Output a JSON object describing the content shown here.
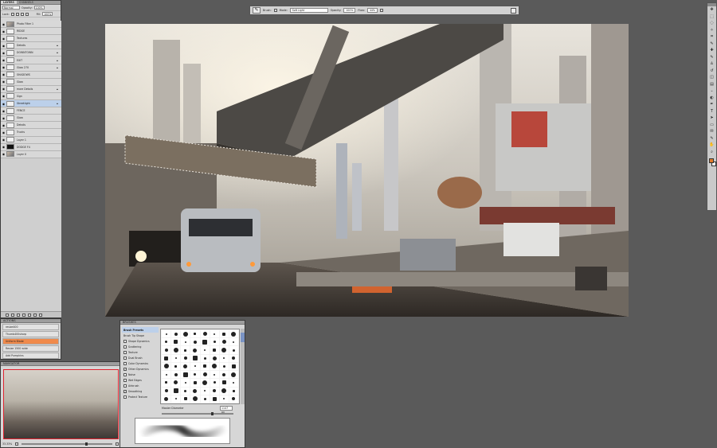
{
  "layers_panel": {
    "tabs": [
      {
        "label": "LAYERS"
      },
      {
        "label": "CHANNELS"
      }
    ],
    "blend_mode": "Normal",
    "opacity_label": "Opacity:",
    "opacity_value": "100%",
    "lock_label": "Lock:",
    "fill_label": "Fill:",
    "fill_value": "100%",
    "layers": [
      {
        "name": "Photo Filter 1",
        "visible": true,
        "locked": false
      },
      {
        "name": "RIDGE",
        "visible": true,
        "locked": false
      },
      {
        "name": "Textures",
        "visible": true,
        "locked": false
      },
      {
        "name": "Details",
        "visible": true,
        "locked": true
      },
      {
        "name": "DOWNTOWN",
        "visible": true,
        "locked": true
      },
      {
        "name": "EXIT",
        "visible": true,
        "locked": true
      },
      {
        "name": "Glow 270",
        "visible": true,
        "locked": true
      },
      {
        "name": "SHADOWS",
        "visible": true,
        "locked": false
      },
      {
        "name": "Glow",
        "visible": true,
        "locked": false
      },
      {
        "name": "more Details",
        "visible": true,
        "locked": true
      },
      {
        "name": "Sign",
        "visible": true,
        "locked": false
      },
      {
        "name": "Streetlight",
        "visible": true,
        "locked": true
      },
      {
        "name": "FENCE",
        "visible": true,
        "locked": false
      },
      {
        "name": "Glow",
        "visible": true,
        "locked": false
      },
      {
        "name": "Details",
        "visible": true,
        "locked": false
      },
      {
        "name": "Trucks",
        "visible": true,
        "locked": false
      },
      {
        "name": "Layer 1",
        "visible": true,
        "locked": false
      },
      {
        "name": "DODGE F4",
        "visible": true,
        "locked": false
      },
      {
        "name": "Layer 0",
        "visible": true,
        "locked": false
      }
    ],
    "selected_index": 11
  },
  "actions_panel": {
    "title": "ACTIONS",
    "items": [
      {
        "label": "resize400"
      },
      {
        "label": "Thumb400sharp"
      },
      {
        "label": "Uniform Blade"
      },
      {
        "label": "Resize 1500 wide"
      },
      {
        "label": "Add Pumpkins"
      }
    ],
    "highlighted_index": 2
  },
  "navigator_panel": {
    "title": "NAVIGATOR",
    "zoom": "33.33%"
  },
  "brushes_panel": {
    "title": "BRUSHES",
    "options": [
      {
        "label": "Brush Presets",
        "checkbox": false,
        "checked": false
      },
      {
        "label": "Brush Tip Shape",
        "checkbox": false,
        "checked": false
      },
      {
        "label": "Shape Dynamics",
        "checkbox": true,
        "checked": false
      },
      {
        "label": "Scattering",
        "checkbox": true,
        "checked": false
      },
      {
        "label": "Texture",
        "checkbox": true,
        "checked": false
      },
      {
        "label": "Dual Brush",
        "checkbox": true,
        "checked": false
      },
      {
        "label": "Color Dynamics",
        "checkbox": true,
        "checked": false
      },
      {
        "label": "Other Dynamics",
        "checkbox": true,
        "checked": true
      },
      {
        "label": "Noise",
        "checkbox": true,
        "checked": false
      },
      {
        "label": "Wet Edges",
        "checkbox": true,
        "checked": false
      },
      {
        "label": "Airbrush",
        "checkbox": true,
        "checked": false
      },
      {
        "label": "Smoothing",
        "checkbox": true,
        "checked": true
      },
      {
        "label": "Protect Texture",
        "checkbox": true,
        "checked": false
      }
    ],
    "diameter_label": "Master Diameter",
    "diameter_value": "1147 px"
  },
  "options_bar": {
    "brush_label": "Brush:",
    "mode_label": "Mode:",
    "mode_value": "Soft Light",
    "opacity_label": "Opacity:",
    "opacity_value": "100%",
    "flow_label": "Flow:",
    "flow_value": "44%"
  },
  "tools": [
    "move-icon",
    "marquee-icon",
    "lasso-icon",
    "magic-wand-icon",
    "crop-icon",
    "eyedropper-icon",
    "healing-icon",
    "brush-icon",
    "clone-stamp-icon",
    "history-brush-icon",
    "eraser-icon",
    "gradient-icon",
    "blur-icon",
    "dodge-icon",
    "pen-icon",
    "type-icon",
    "path-select-icon",
    "shape-icon",
    "notes-icon",
    "eyedropper2-icon",
    "hand-icon",
    "zoom-icon"
  ],
  "colors": {
    "foreground": "#e07a2a",
    "background": "#ffffff",
    "workspace": "#5a5a5a",
    "selection": "#bcd0ea",
    "action_highlight": "#f08a4b"
  }
}
